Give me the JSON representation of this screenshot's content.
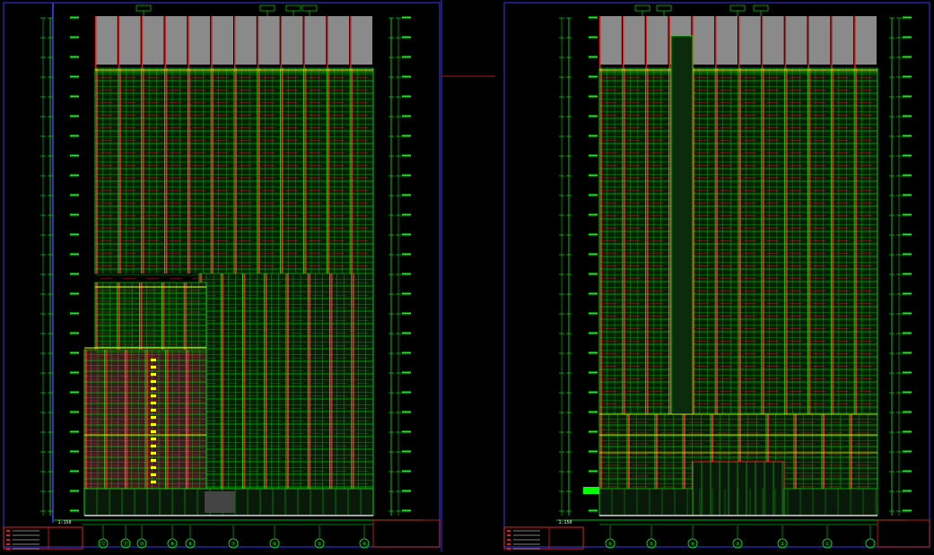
{
  "colors": {
    "background": "#000000",
    "grid": "#00ff00",
    "wall": "#e02020",
    "parapet": "#8a8a8a",
    "frame": "#3030c8",
    "annotation": "#ffffff",
    "podium_fill": "#6a3a3a",
    "highlight": "#ffff00"
  },
  "sheets": [
    {
      "grid_bubbles": [
        "⑫",
        "⑪",
        "⑩",
        "⑨",
        "⑧",
        "⑦",
        "⑥",
        "⑤",
        "④",
        "③",
        "②",
        "①"
      ],
      "scale_label": "1:150"
    },
    {
      "grid_bubbles": [
        "⑥",
        "⑤",
        "④",
        "③",
        "②",
        "①"
      ],
      "scale_label": "1:150"
    }
  ]
}
